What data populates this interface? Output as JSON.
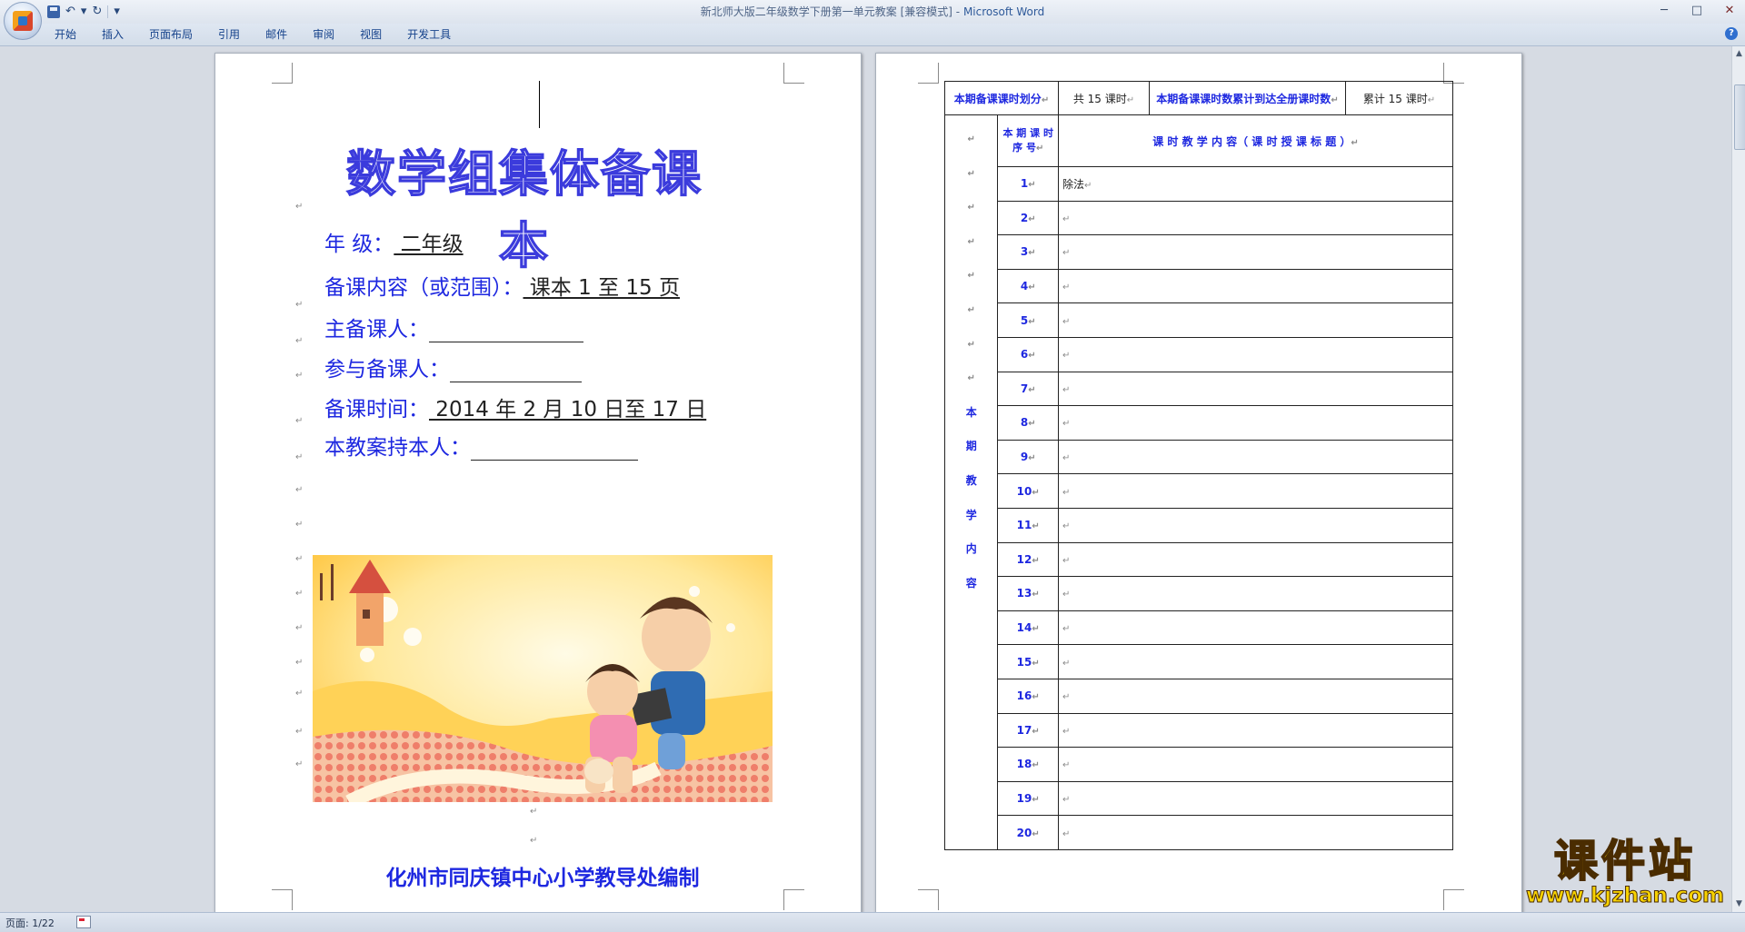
{
  "window": {
    "doc_title": "新北师大版二年级数学下册第一单元教案 [兼容模式]",
    "separator": " - ",
    "app_name": "Microsoft Word",
    "minimize": "─",
    "maximize": "□",
    "close": "✕"
  },
  "qat": {
    "undo": "↶",
    "undo_dropdown": "▾",
    "redo": "↻",
    "customize": "▾"
  },
  "ribbon": {
    "tabs": [
      {
        "label": "开始"
      },
      {
        "label": "插入"
      },
      {
        "label": "页面布局"
      },
      {
        "label": "引用"
      },
      {
        "label": "邮件"
      },
      {
        "label": "审阅"
      },
      {
        "label": "视图"
      },
      {
        "label": "开发工具"
      }
    ],
    "help": "?"
  },
  "cover": {
    "title": "数学组集体备课本",
    "grade_label": "年      级：",
    "grade_value": " 二年级 ",
    "range_label": "备课内容（或范围）：",
    "range_value": " 课本 1 至 15 页 ",
    "lead_label": "主备课人：",
    "participants_label": "参与备课人：",
    "time_label": "备课时间：",
    "time_value": " 2014 年 2 月 10 日至 17 日",
    "holder_label": "本教案持本人：",
    "footer": "化州市同庆镇中心小学教导处编制"
  },
  "marks": {
    "para": "↵"
  },
  "plan_table": {
    "header_left": "本期备课课时划分",
    "header_total": "共 15 课时",
    "header_mid": "本期备课课时数累计到达全册课时数",
    "header_cum": "累计 15 课时",
    "col_idx": "本 期 课 时 序 号",
    "col_content": "课 时 教 学 内 容（ 课 时 授 课 标 题 ）",
    "side_label_chars": [
      "本",
      "期",
      "教",
      "学",
      "内",
      "容"
    ],
    "rows": [
      {
        "idx": "1",
        "content": "除法"
      },
      {
        "idx": "2",
        "content": ""
      },
      {
        "idx": "3",
        "content": ""
      },
      {
        "idx": "4",
        "content": ""
      },
      {
        "idx": "5",
        "content": ""
      },
      {
        "idx": "6",
        "content": ""
      },
      {
        "idx": "7",
        "content": ""
      },
      {
        "idx": "8",
        "content": ""
      },
      {
        "idx": "9",
        "content": ""
      },
      {
        "idx": "10",
        "content": ""
      },
      {
        "idx": "11",
        "content": ""
      },
      {
        "idx": "12",
        "content": ""
      },
      {
        "idx": "13",
        "content": ""
      },
      {
        "idx": "14",
        "content": ""
      },
      {
        "idx": "15",
        "content": ""
      },
      {
        "idx": "16",
        "content": ""
      },
      {
        "idx": "17",
        "content": ""
      },
      {
        "idx": "18",
        "content": ""
      },
      {
        "idx": "19",
        "content": ""
      },
      {
        "idx": "20",
        "content": ""
      }
    ]
  },
  "scrollbar": {
    "up": "▲",
    "down": "▼"
  },
  "status": {
    "page_count": "页面: 1/22"
  },
  "watermark": {
    "cn": "课件站",
    "url": "www.kjzhan.com"
  },
  "colors": {
    "accent_blue": "#1e28e0",
    "ribbon_text": "#15428b",
    "watermark_yellow": "#f7d200"
  }
}
